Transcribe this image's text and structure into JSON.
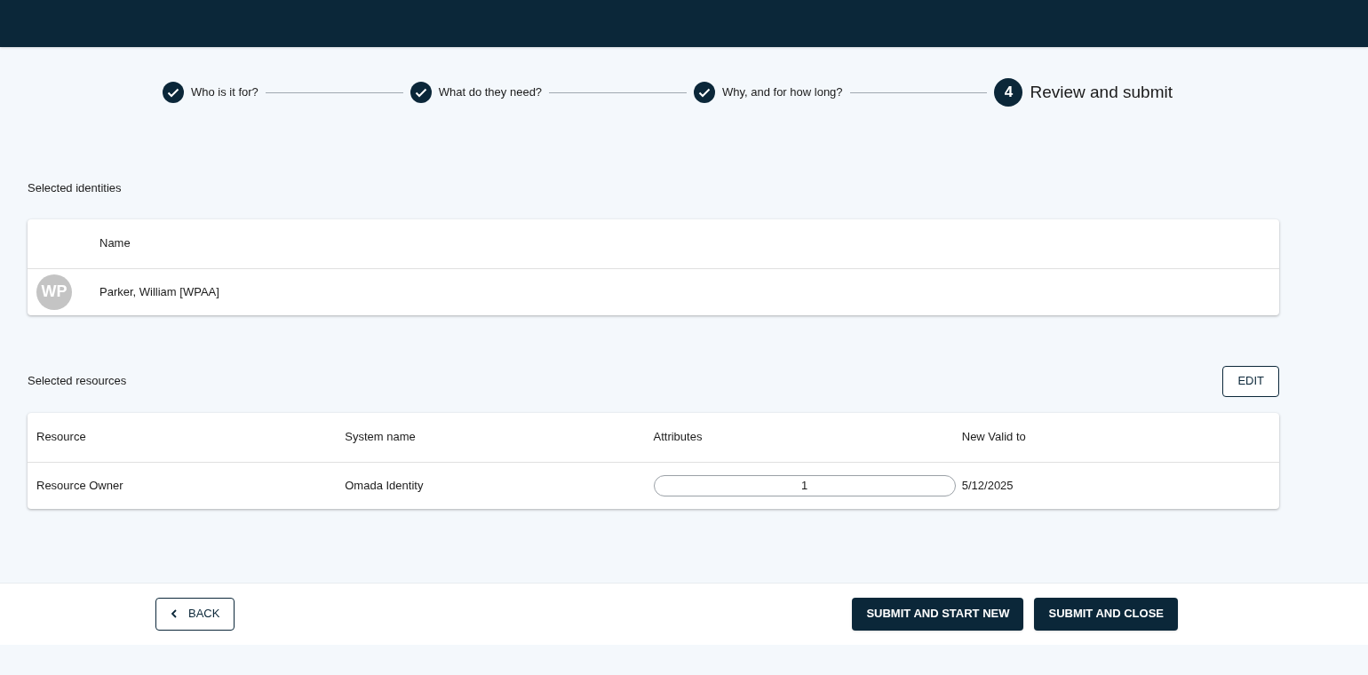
{
  "steps": [
    {
      "label": "Who is it for?",
      "kind": "done"
    },
    {
      "label": "What do they need?",
      "kind": "done"
    },
    {
      "label": "Why, and for how long?",
      "kind": "done"
    },
    {
      "label": "Review and submit",
      "kind": "current",
      "number": "4"
    }
  ],
  "identities": {
    "title": "Selected identities",
    "columns": [
      "Name"
    ],
    "rows": [
      {
        "initials": "WP",
        "name": "Parker, William [WPAA]"
      }
    ]
  },
  "resources": {
    "title": "Selected resources",
    "edit_button": "EDIT",
    "columns": [
      "Resource",
      "System name",
      "Attributes",
      "New Valid to"
    ],
    "rows": [
      {
        "resource": "Resource Owner",
        "system": "Omada Identity",
        "attributes": "1",
        "valid_to": "5/12/2025"
      }
    ]
  },
  "footer": {
    "back": "BACK",
    "submit_new": "SUBMIT AND START NEW",
    "submit_close": "SUBMIT AND CLOSE"
  }
}
